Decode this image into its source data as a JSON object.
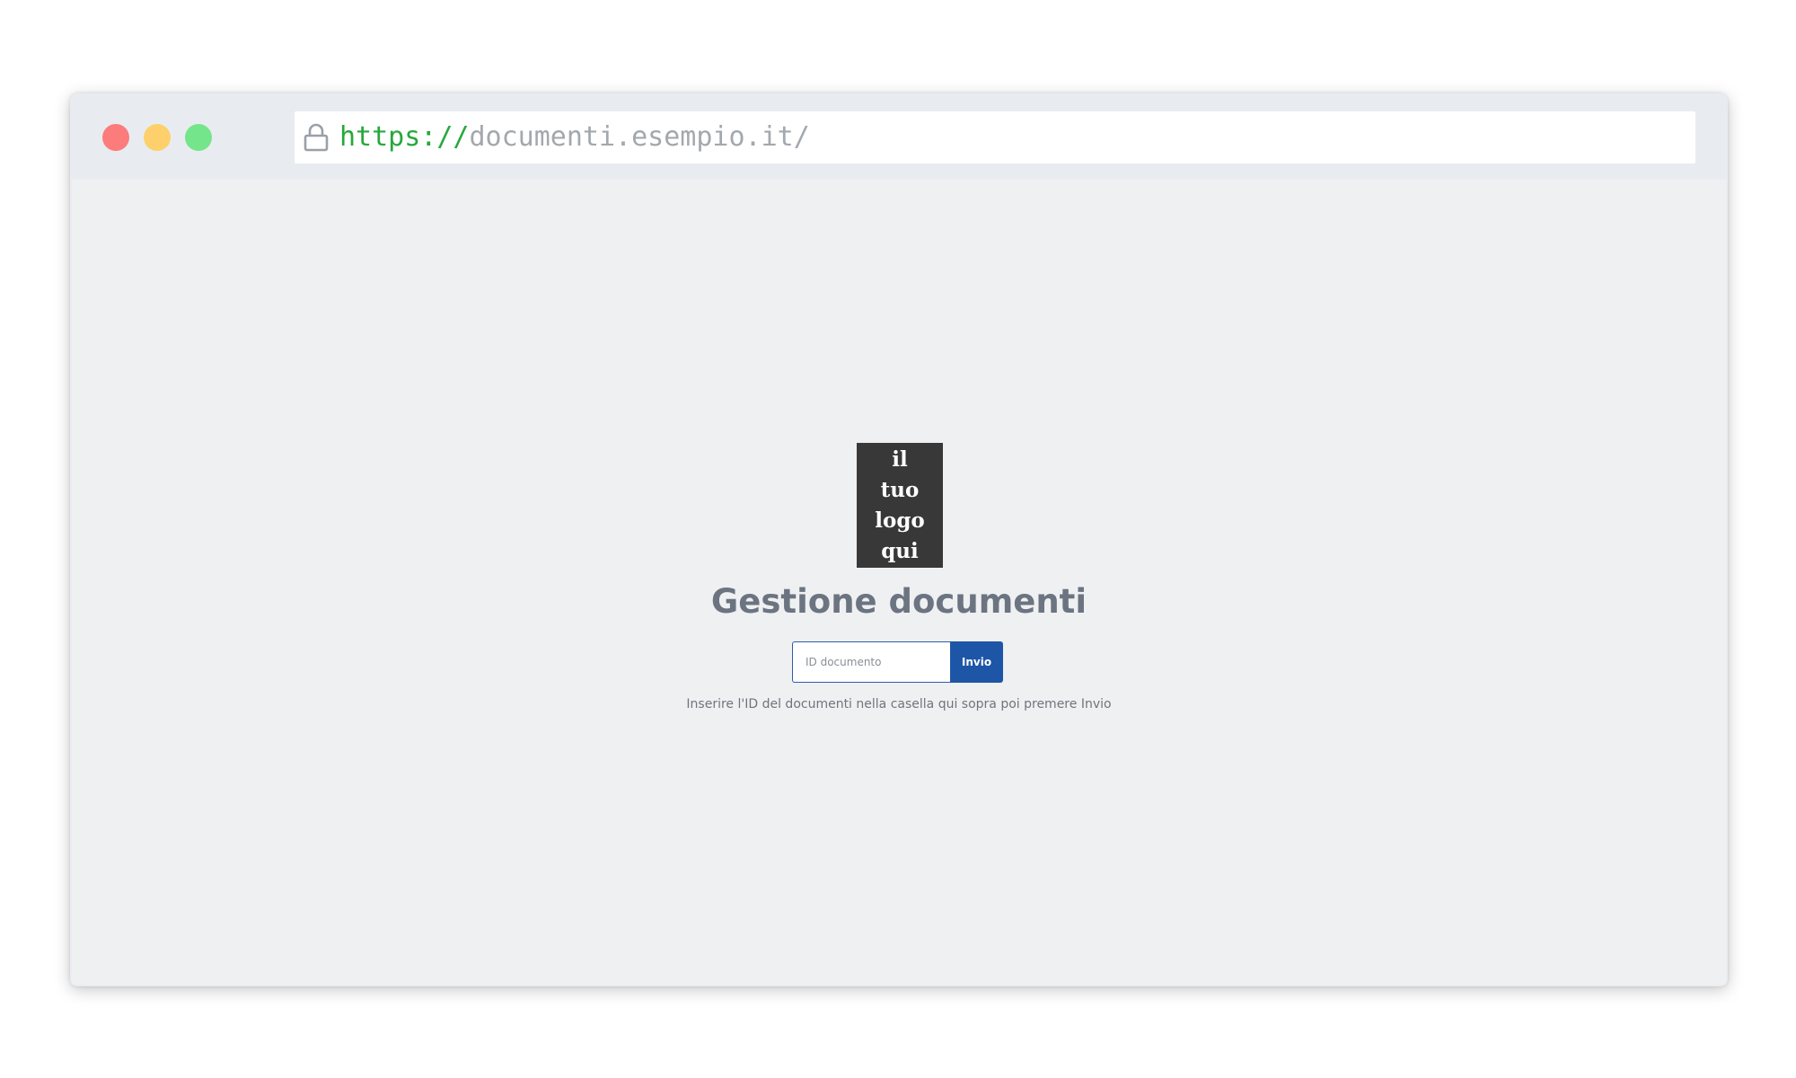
{
  "window": {
    "controls": {
      "close_color": "#fc7b7b",
      "minimize_color": "#fdd06b",
      "maximize_color": "#74e58a"
    },
    "address_bar": {
      "scheme": "https://",
      "host": "documenti.esempio.it/",
      "lock_icon": "lock-icon"
    }
  },
  "page": {
    "logo_lines": [
      "il",
      "tuo",
      "logo",
      "qui"
    ],
    "title": "Gestione documenti",
    "form": {
      "input_placeholder": "ID documento",
      "input_value": "",
      "submit_label": "Invio"
    },
    "help_text": "Inserire l'ID del documenti nella casella qui sopra poi premere Invio"
  },
  "colors": {
    "accent": "#1d56a6",
    "url_scheme": "#27a83b",
    "title": "#6b7480"
  }
}
